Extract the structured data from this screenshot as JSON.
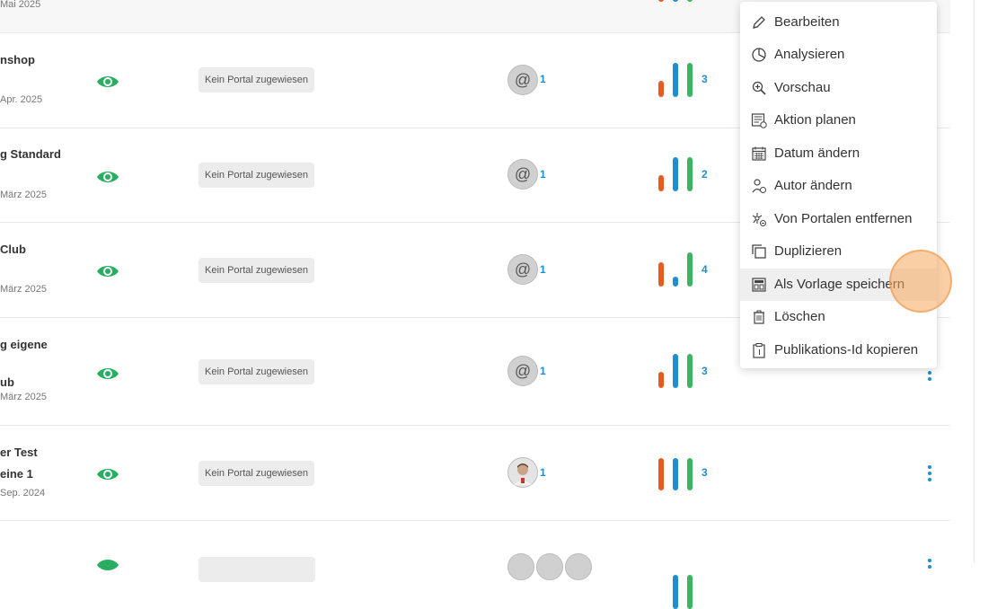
{
  "rows": [
    {
      "date": "Mai 2025"
    },
    {
      "title": "nshop",
      "date": "Apr. 2025",
      "portal": "Kein Portal zugewiesen",
      "author_count": "1",
      "bar_count": "3",
      "bars": [
        0.47,
        1.0,
        1.0
      ]
    },
    {
      "title": "g Standard",
      "date": "März 2025",
      "portal": "Kein Portal zugewiesen",
      "author_count": "1",
      "bar_count": "2",
      "bars": [
        0.47,
        1.0,
        1.0
      ]
    },
    {
      "title": "Club",
      "date": "März 2025",
      "portal": "Kein Portal zugewiesen",
      "author_count": "1",
      "bar_count": "4",
      "bars": [
        0.71,
        0.29,
        1.0
      ]
    },
    {
      "title_line1": "g eigene",
      "title_line2": "ub",
      "date": "März 2025",
      "portal": "Kein Portal zugewiesen",
      "author_count": "1",
      "bar_count": "3",
      "bars": [
        0.47,
        1.0,
        1.0
      ]
    },
    {
      "title_line1": "er Test",
      "title_line2": "eine 1",
      "date": "Sep. 2024",
      "portal": "Kein Portal zugewiesen",
      "author_count": "1",
      "bar_count": "3",
      "bars": [
        1.0,
        1.0,
        1.0
      ]
    }
  ],
  "avatar_symbol": "@",
  "menu": {
    "items": [
      {
        "label": "Bearbeiten",
        "icon": "pencil-icon"
      },
      {
        "label": "Analysieren",
        "icon": "pie-chart-icon"
      },
      {
        "label": "Vorschau",
        "icon": "zoom-in-icon"
      },
      {
        "label": "Aktion planen",
        "icon": "schedule-icon"
      },
      {
        "label": "Datum ändern",
        "icon": "calendar-icon"
      },
      {
        "label": "Autor ändern",
        "icon": "author-icon"
      },
      {
        "label": "Von Portalen entfernen",
        "icon": "network-remove-icon"
      },
      {
        "label": "Duplizieren",
        "icon": "duplicate-icon"
      },
      {
        "label": "Als Vorlage speichern",
        "icon": "template-icon"
      },
      {
        "label": "Löschen",
        "icon": "trash-icon"
      },
      {
        "label": "Publikations-Id kopieren",
        "icon": "clipboard-icon"
      }
    ],
    "highlighted_index": 8
  },
  "colors": {
    "orange": "#e95a1e",
    "blue": "#1d8fd1",
    "green": "#3db462",
    "eye": "#27ae60"
  }
}
